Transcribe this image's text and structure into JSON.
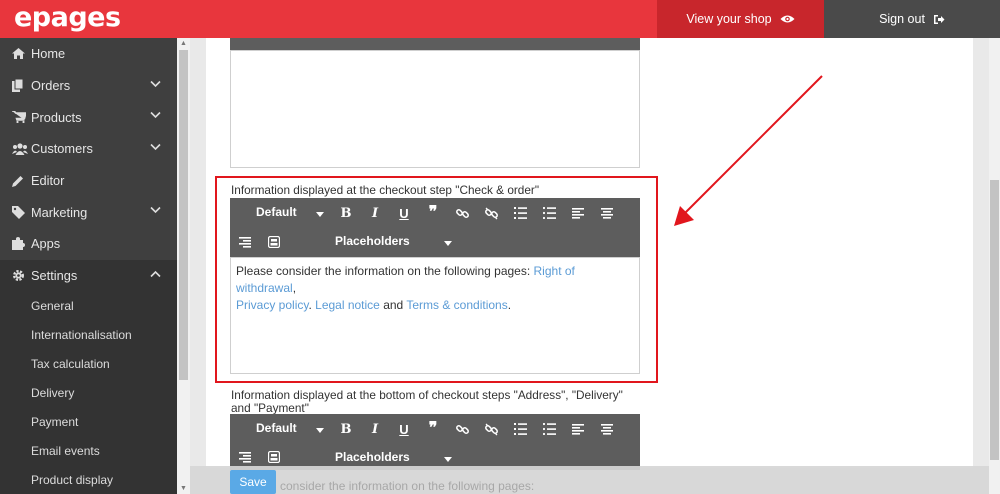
{
  "header": {
    "logo": "epages",
    "view_shop": "View your shop",
    "sign_out": "Sign out"
  },
  "sidebar": {
    "items": [
      {
        "label": "Home",
        "icon": "home-icon"
      },
      {
        "label": "Orders",
        "icon": "orders-icon"
      },
      {
        "label": "Products",
        "icon": "cart-icon"
      },
      {
        "label": "Customers",
        "icon": "users-icon"
      },
      {
        "label": "Editor",
        "icon": "pencil-icon"
      },
      {
        "label": "Marketing",
        "icon": "tag-icon"
      },
      {
        "label": "Apps",
        "icon": "puzzle-icon"
      },
      {
        "label": "Settings",
        "icon": "gear-icon"
      }
    ],
    "settings_sub": [
      "General",
      "Internationalisation",
      "Tax calculation",
      "Delivery",
      "Payment",
      "Email events",
      "Product display"
    ]
  },
  "editor_check": {
    "label": "Information displayed at the checkout step \"Check & order\"",
    "style_value": "Default",
    "placeholders": "Placeholders",
    "text_pre": "Please consider the information on the following pages: ",
    "link1": "Right of withdrawal",
    "comma1": ",",
    "link2": "Privacy policy",
    "sep2": ". ",
    "link3": "Legal notice",
    "and": " and ",
    "link4": "Terms & conditions",
    "end": "."
  },
  "editor_bottom": {
    "label": "Information displayed at the bottom of checkout steps \"Address\", \"Delivery\" and \"Payment\"",
    "style_value": "Default",
    "placeholders": "Placeholders",
    "ghost_text": "consider the information on the following pages:"
  },
  "footer": {
    "save": "Save"
  },
  "colors": {
    "brand_red": "#e8363d",
    "sidebar_bg": "#3f3f3f",
    "toolbar_bg": "#5d5d5d",
    "link": "#5b9bd5",
    "highlight": "#e1161d",
    "save": "#5aa9e6"
  }
}
